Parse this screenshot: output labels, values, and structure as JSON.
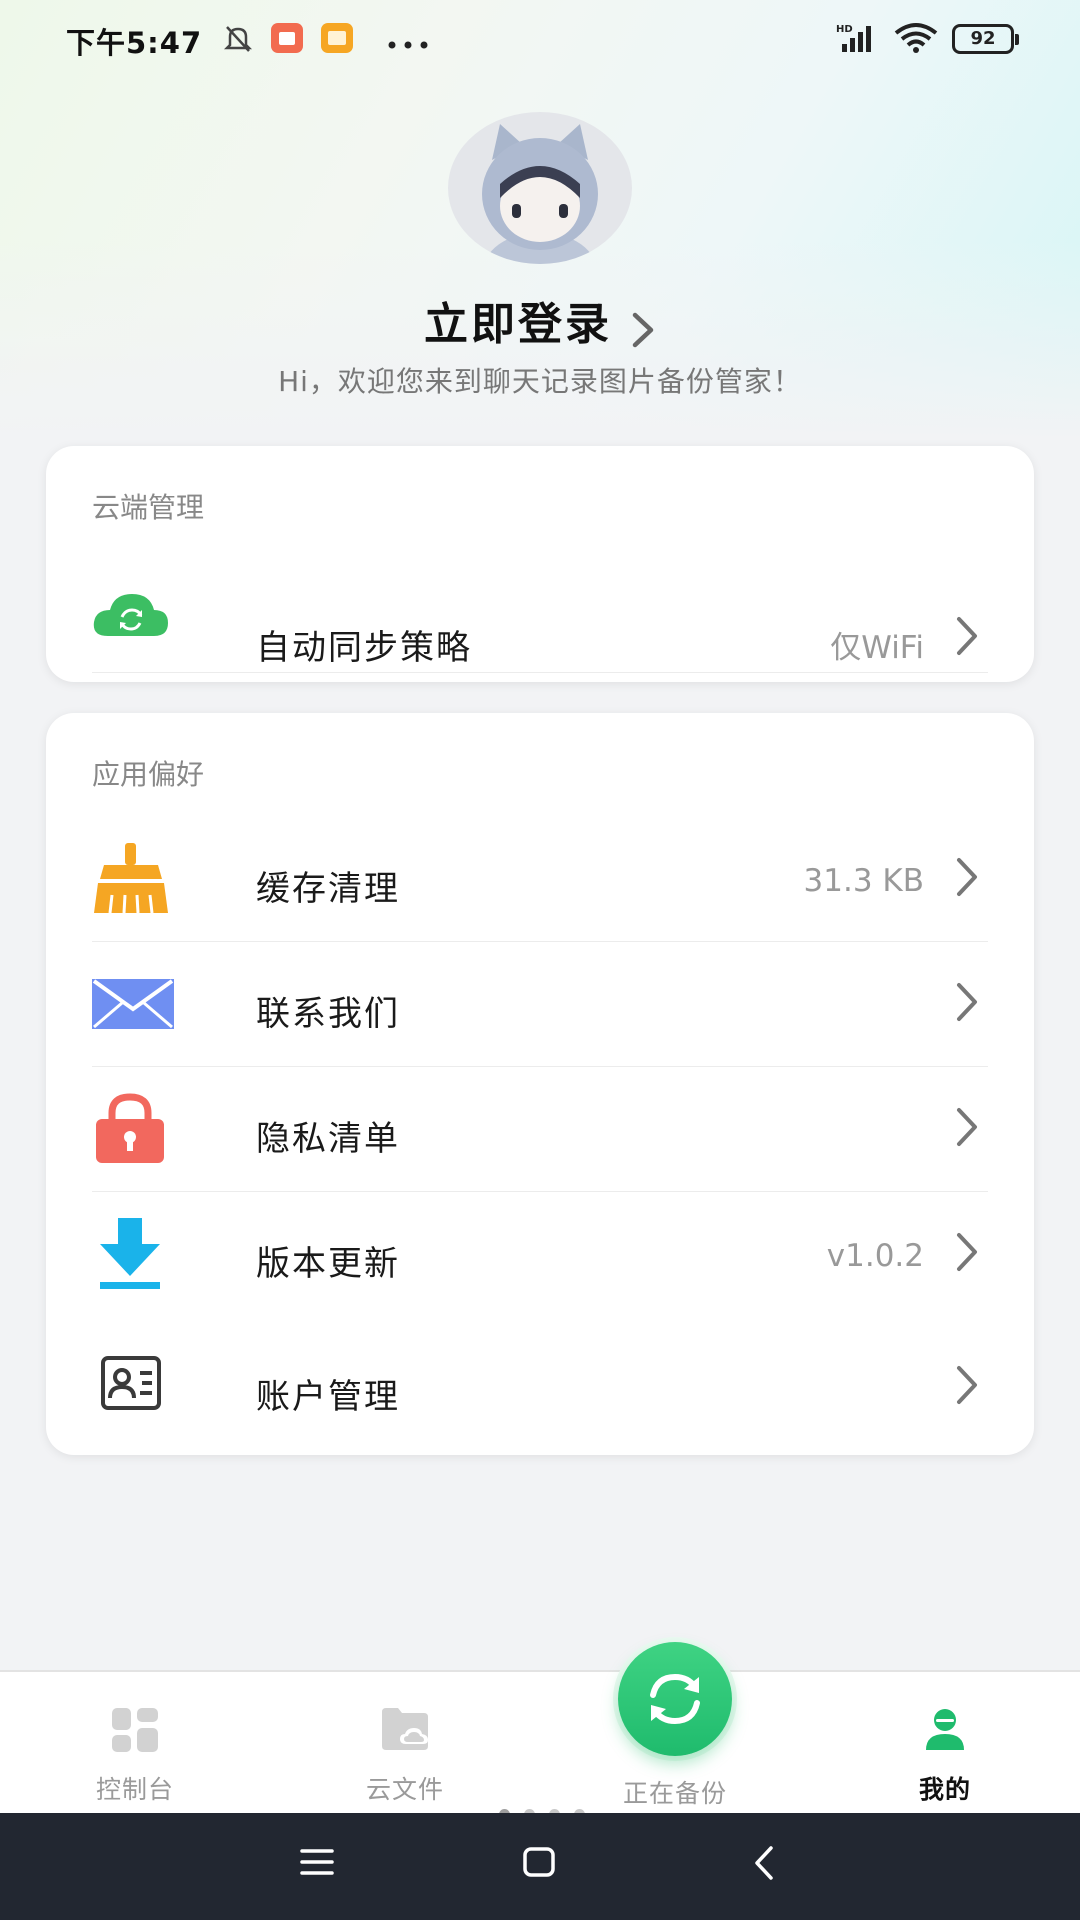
{
  "status_bar": {
    "time": "下午5:47",
    "battery": "92",
    "icons": [
      "bell-off-icon",
      "app-notification-icon",
      "gallery-notification-icon",
      "more-dots-icon",
      "hd-signal-icon",
      "wifi-icon",
      "battery-icon"
    ]
  },
  "profile": {
    "login_label": "立即登录",
    "welcome": "Hi，欢迎您来到聊天记录图片备份管家！"
  },
  "cloud_section": {
    "title": "云端管理",
    "items": [
      {
        "label": "自动同步策略",
        "value": "仅WiFi",
        "icon": "cloud-sync-icon"
      }
    ]
  },
  "prefs_section": {
    "title": "应用偏好",
    "items": [
      {
        "label": "缓存清理",
        "value": "31.3 KB",
        "icon": "broom-icon"
      },
      {
        "label": "联系我们",
        "value": "",
        "icon": "mail-icon"
      },
      {
        "label": "隐私清单",
        "value": "",
        "icon": "lock-icon"
      },
      {
        "label": "版本更新",
        "value": "v1.0.2",
        "icon": "download-icon"
      },
      {
        "label": "账户管理",
        "value": "",
        "icon": "id-card-icon"
      }
    ]
  },
  "bottom_nav": {
    "items": [
      {
        "label": "控制台",
        "icon": "dashboard-icon"
      },
      {
        "label": "云文件",
        "icon": "cloud-folder-icon"
      },
      {
        "label": "正在备份",
        "icon": "sync-icon"
      },
      {
        "label": "我的",
        "icon": "user-icon",
        "active": true
      }
    ]
  },
  "colors": {
    "accent_green": "#1fbb6d",
    "cloud_green": "#3cbe63",
    "broom_orange": "#f5a623",
    "mail_blue": "#6f8ff2",
    "lock_red": "#f2685e",
    "download_blue": "#1ab3ea"
  }
}
